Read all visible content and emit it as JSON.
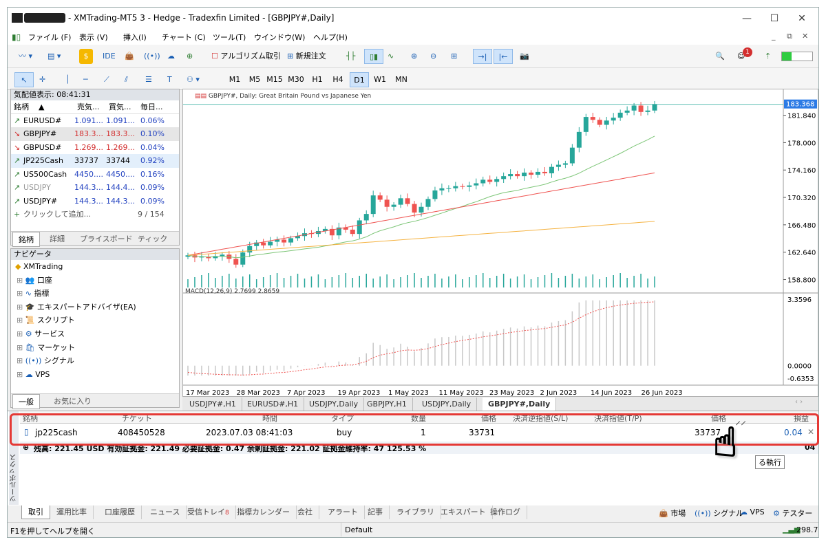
{
  "window": {
    "title": "- XMTrading-MT5 3 - Hedge - Tradexfin Limited - [GBPJPY#,Daily]"
  },
  "menu": [
    "ファイル (F)",
    "表示 (V)",
    "挿入(I)",
    "チャート (C)",
    "ツール(T)",
    "ウインドウ(W)",
    "ヘルプ(H)"
  ],
  "toolbar": {
    "ide": "IDE",
    "algo": "アルゴリズム取引",
    "neworder": "新規注文",
    "notif": "1"
  },
  "timeframes": [
    "M1",
    "M5",
    "M15",
    "M30",
    "H1",
    "H4",
    "D1",
    "W1",
    "MN"
  ],
  "active_timeframe": "D1",
  "marketwatch": {
    "header": "気配値表示: 08:41:31",
    "cols": [
      "銘柄",
      "売気...",
      "買気...",
      "毎日..."
    ],
    "rows": [
      {
        "sym": "EURUSD#",
        "bid": "1.091...",
        "ask": "1.091...",
        "chg": "0.06%",
        "dir": "up",
        "color": "#1f3fbf"
      },
      {
        "sym": "GBPJPY#",
        "bid": "183.3...",
        "ask": "183.3...",
        "chg": "0.10%",
        "dir": "down",
        "color": "#d32f2f"
      },
      {
        "sym": "GBPUSD#",
        "bid": "1.269...",
        "ask": "1.269...",
        "chg": "0.04%",
        "dir": "down",
        "color": "#d32f2f"
      },
      {
        "sym": "JP225Cash",
        "bid": "33737",
        "ask": "33744",
        "chg": "0.92%",
        "dir": "up",
        "color": "#000"
      },
      {
        "sym": "US500Cash",
        "bid": "4450....",
        "ask": "4450....",
        "chg": "0.16%",
        "dir": "up",
        "color": "#1f3fbf"
      },
      {
        "sym": "USDJPY",
        "bid": "144.3...",
        "ask": "144.4...",
        "chg": "0.09%",
        "dir": "up",
        "color": "#1f3fbf",
        "grey": true
      },
      {
        "sym": "USDJPY#",
        "bid": "144.3...",
        "ask": "144.3...",
        "chg": "0.09%",
        "dir": "up",
        "color": "#1f3fbf"
      }
    ],
    "add": "クリックして追加...",
    "count": "9 / 154",
    "tabs": [
      "銘柄",
      "詳細",
      "プライスボード",
      "ティック"
    ]
  },
  "navigator": {
    "header": "ナビゲータ",
    "root": "XMTrading",
    "items": [
      "口座",
      "指標",
      "エキスパートアドバイザ(EA)",
      "スクリプト",
      "サービス",
      "マーケット",
      "シグナル",
      "VPS"
    ],
    "tabs": [
      "一般",
      "お気に入り"
    ]
  },
  "chart": {
    "title": "GBPJPY#, Daily:  Great Britain Pound vs Japanese Yen",
    "price_tag": "183.368",
    "macd_label": "MACD(12,26,9) 2.7699 2.8659"
  },
  "chart_data": {
    "type": "candlestick",
    "symbol": "GBPJPY#",
    "timeframe": "Daily",
    "y_ticks": [
      "181.840",
      "178.000",
      "174.160",
      "170.320",
      "166.480",
      "162.640",
      "158.800"
    ],
    "macd_ticks": [
      "3.3596",
      "0.0000",
      "-0.6353"
    ],
    "x_ticks": [
      "17 Mar 2023",
      "28 Mar 2023",
      "7 Apr 2023",
      "19 Apr 2023",
      "1 May 2023",
      "11 May 2023",
      "23 May 2023",
      "2 Jun 2023",
      "14 Jun 2023",
      "26 Jun 2023"
    ],
    "closes": [
      162.2,
      161.9,
      162.0,
      161.8,
      162.1,
      162.3,
      161.7,
      160.9,
      162.6,
      163.5,
      164.0,
      163.6,
      164.1,
      164.4,
      164.0,
      164.6,
      164.9,
      165.3,
      165.2,
      165.6,
      165.9,
      165.0,
      166.1,
      165.8,
      165.2,
      167.1,
      168.0,
      170.6,
      170.0,
      169.0,
      169.3,
      170.2,
      169.4,
      168.2,
      169.0,
      170.1,
      171.3,
      171.6,
      171.6,
      171.9,
      171.8,
      172.0,
      172.3,
      172.8,
      172.5,
      172.9,
      173.3,
      173.6,
      173.3,
      173.8,
      173.5,
      173.9,
      173.7,
      174.6,
      174.9,
      175.1,
      177.3,
      179.5,
      181.6,
      181.2,
      180.5,
      181.1,
      181.5,
      182.2,
      182.5,
      183.2,
      182.3,
      182.5,
      183.4
    ]
  },
  "chart_tabs": [
    "USDJPY#,H1",
    "EURUSD#,H1",
    "USDJPY,Daily",
    "GBPJPY,H1",
    "USDJPY,Daily",
    "GBPJPY#,Daily"
  ],
  "active_chart_tab": "GBPJPY#,Daily",
  "trade": {
    "cols": [
      "銘柄",
      "チケット",
      "時間",
      "タイプ",
      "数量",
      "価格",
      "決済逆指値(S/L)",
      "決済指値(T/P)",
      "価格",
      "損益"
    ],
    "row": {
      "symbol": "jp225cash",
      "ticket": "408450528",
      "time": "2023.07.03 08:41:03",
      "type": "buy",
      "volume": "1",
      "price": "33731",
      "sl": "",
      "tp": "",
      "cur": "33737",
      "profit": "0.04"
    },
    "summary": "残高: 221.45 USD  有効証拠金: 221.49  必要証拠金: 0.47  余剰証拠金: 221.02  証拠金維持率: 47 125.53 %",
    "summary_right": "04",
    "tooltip": "る執行"
  },
  "toolbox_label": "ツールボックス",
  "toolbox_tabs": [
    "取引",
    "運用比率",
    "口座履歴",
    "ニュース",
    "受信トレイ",
    "指標カレンダー",
    "会社",
    "アラート",
    "記事",
    "ライブラリ",
    "エキスパート",
    "操作ログ"
  ],
  "inbox_count": "8",
  "toolbox_right": [
    "市場",
    "シグナル",
    "VPS",
    "テスター"
  ],
  "statusbar": {
    "help": "F1を押してヘルプを開く",
    "profile": "Default",
    "ping": "298.7"
  }
}
